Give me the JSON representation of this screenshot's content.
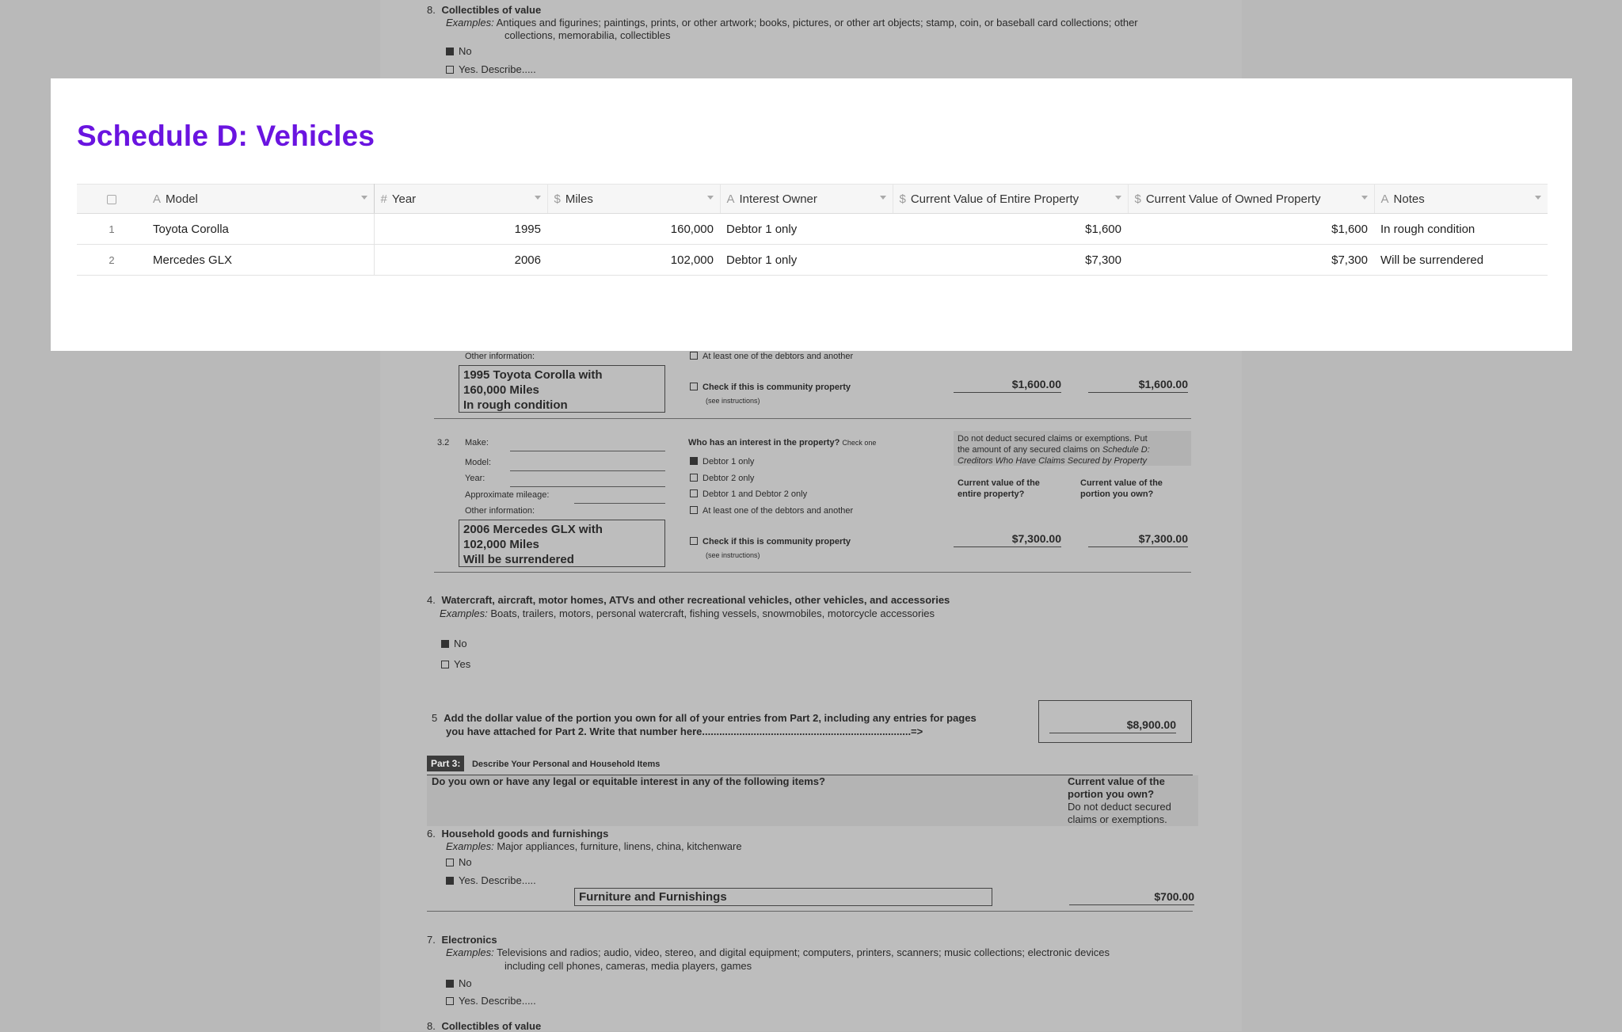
{
  "background_doc": {
    "top": {
      "item8_num": "8.",
      "item8_title": "Collectibles of value",
      "item8_examples_label": "Examples:",
      "item8_examples_text": "Antiques and figurines; paintings, prints, or other artwork; books, pictures, or other art objects; stamp, coin, or baseball card collections; other",
      "item8_examples_text2": "collections, memorabilia, collectibles",
      "no": "No",
      "yes_describe": "Yes.  Describe....."
    },
    "vehicle1": {
      "other_info_label": "Other information:",
      "at_least_one": "At least one of the debtors and another",
      "info_text": [
        "1995 Toyota Corolla with",
        "160,000 Miles",
        "In rough condition"
      ],
      "community": "Check if this is community property",
      "see_instructions": "(see instructions)",
      "value_entire": "$1,600.00",
      "value_portion": "$1,600.00"
    },
    "vehicle2": {
      "num": "3.2",
      "make_label": "Make:",
      "model_label": "Model:",
      "year_label": "Year:",
      "mileage_label": "Approximate mileage:",
      "other_info_label": "Other information:",
      "who_has": "Who has an interest in the property?",
      "check_one": "Check one",
      "opt1": "Debtor 1 only",
      "opt2": "Debtor 2 only",
      "opt3": "Debtor 1 and Debtor 2 only",
      "opt4": "At least one of the debtors and another",
      "community": "Check if this is community property",
      "see_instructions": "(see instructions)",
      "note_lines": [
        "Do not deduct secured claims or exemptions. Put",
        "the amount of any secured claims on "
      ],
      "note_italic": "Schedule D:",
      "note_italic2": "Creditors Who Have Claims Secured by Property",
      "cv_entire": [
        "Current value of the",
        "entire property?"
      ],
      "cv_portion": [
        "Current value of the",
        "portion you own?"
      ],
      "info_text": [
        "2006 Mercedes GLX with",
        "102,000 Miles",
        "Will be surrendered"
      ],
      "value_entire": "$7,300.00",
      "value_portion": "$7,300.00"
    },
    "item4": {
      "num": "4.",
      "title": "Watercraft, aircraft, motor homes, ATVs and other recreational vehicles, other vehicles, and accessories",
      "examples_label": "Examples:",
      "examples_text": "Boats, trailers, motors, personal watercraft, fishing vessels, snowmobiles, motorcycle accessories",
      "no": "No",
      "yes": "Yes"
    },
    "item5": {
      "num": "5",
      "line1": "Add the dollar value of the portion you own for all of your entries from Part 2, including any entries for pages",
      "line2": "you have attached for Part 2. Write that number here.........................................................................=>",
      "total": "$8,900.00"
    },
    "part3": {
      "tag": "Part 3:",
      "title": "Describe Your Personal and  Household Items",
      "question": "Do you own or have any legal or equitable interest in any of the following items?",
      "cv": [
        "Current value of the",
        "portion you own?"
      ],
      "cv_note": [
        "Do not deduct secured",
        "claims or exemptions."
      ]
    },
    "item6": {
      "num": "6.",
      "title": "Household goods and furnishings",
      "examples_label": "Examples:",
      "examples_text": "Major appliances, furniture, linens, china, kitchenware",
      "no": "No",
      "yes_describe": "Yes.  Describe.....",
      "describe_text": "Furniture and Furnishings",
      "value": "$700.00"
    },
    "item7": {
      "num": "7.",
      "title": "Electronics",
      "examples_label": "Examples:",
      "examples_text": "Televisions and radios; audio, video, stereo, and digital equipment; computers, printers, scanners; music collections; electronic devices",
      "examples_text2": "including cell phones, cameras, media players, games",
      "no": "No",
      "yes_describe": "Yes.  Describe....."
    },
    "item8b": {
      "num": "8.",
      "title": "Collectibles of value"
    }
  },
  "card": {
    "title": "Schedule D: Vehicles",
    "columns": [
      {
        "icon": "A",
        "label": "Model"
      },
      {
        "icon": "#",
        "label": "Year"
      },
      {
        "icon": "$",
        "label": "Miles"
      },
      {
        "icon": "A",
        "label": "Interest Owner"
      },
      {
        "icon": "$",
        "label": "Current Value of Entire Property"
      },
      {
        "icon": "$",
        "label": "Current Value of Owned Property"
      },
      {
        "icon": "A",
        "label": "Notes"
      }
    ],
    "rows": [
      {
        "idx": "1",
        "model": "Toyota Corolla",
        "year": "1995",
        "miles": "160,000",
        "owner": "Debtor 1 only",
        "entire": "$1,600",
        "owned": "$1,600",
        "notes": "In rough condition"
      },
      {
        "idx": "2",
        "model": "Mercedes GLX",
        "year": "2006",
        "miles": "102,000",
        "owner": "Debtor 1 only",
        "entire": "$7,300",
        "owned": "$7,300",
        "notes": "Will be surrendered"
      }
    ]
  },
  "colors": {
    "accent": "#6a14e0",
    "page_bg": "#b9b9b9"
  }
}
